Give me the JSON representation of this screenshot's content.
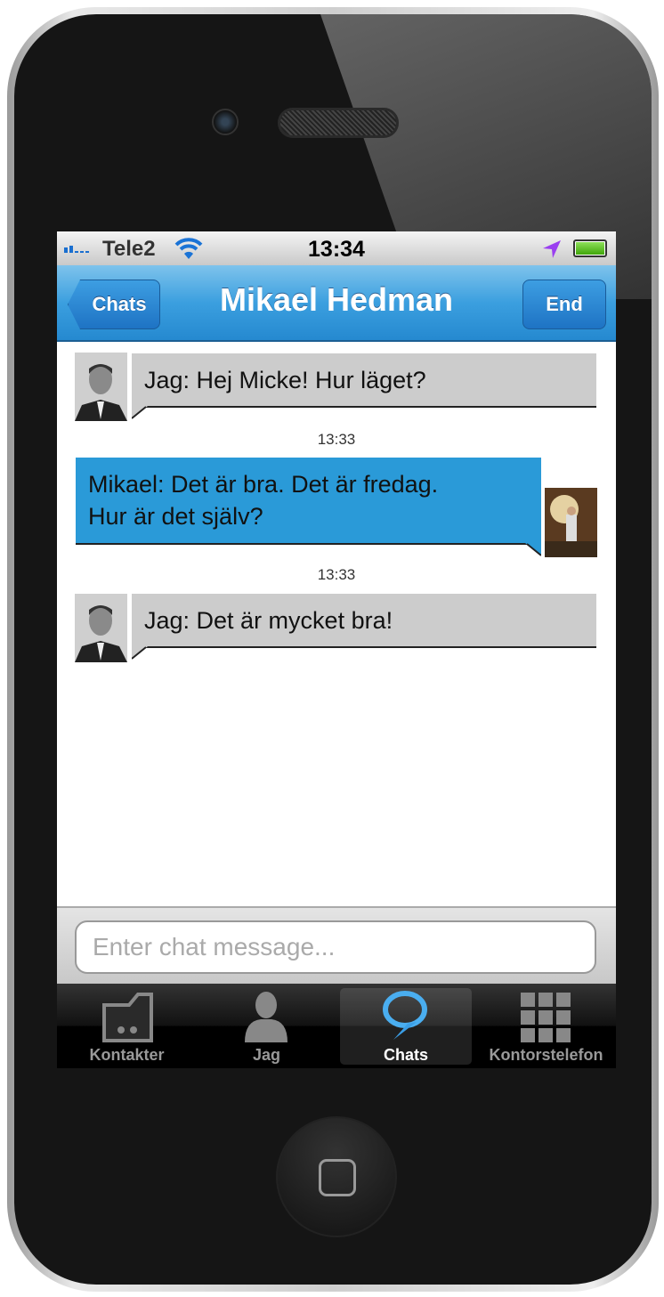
{
  "status_bar": {
    "carrier": "Tele2",
    "time": "13:34"
  },
  "nav": {
    "back_label": "Chats",
    "title": "Mikael Hedman",
    "end_label": "End"
  },
  "messages": [
    {
      "sender": "me",
      "text": "Jag: Hej Micke! Hur läget?",
      "time": "13:33"
    },
    {
      "sender": "contact",
      "text_line1": "Mikael: Det är bra. Det är fredag.",
      "text_line2": "Hur är det själv?",
      "time": "13:33"
    },
    {
      "sender": "me",
      "text": "Jag: Det är mycket bra!"
    }
  ],
  "input": {
    "placeholder": "Enter chat message..."
  },
  "tabs": [
    {
      "label": "Kontakter",
      "icon": "contacts-folder-icon"
    },
    {
      "label": "Jag",
      "icon": "person-icon"
    },
    {
      "label": "Chats",
      "icon": "chat-bubble-icon",
      "active": true
    },
    {
      "label": "Kontorstelefon",
      "icon": "keypad-grid-icon"
    }
  ],
  "colors": {
    "accent": "#2a9ad8",
    "nav": "#3b9fdf",
    "bubble_me": "#cccccc",
    "battery": "#4fc10f"
  }
}
